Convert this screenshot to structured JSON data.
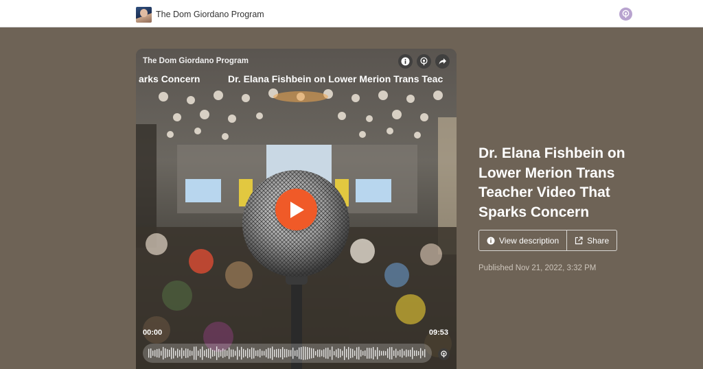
{
  "header": {
    "show_name": "The Dom Giordano Program",
    "avatar_icon": "host-avatar",
    "right_icon": "podcast-icon"
  },
  "player": {
    "show_name": "The Dom Giordano Program",
    "marquee_left": "arks Concern",
    "marquee_right": "Dr. Elana Fishbein on Lower Merion Trans Teac",
    "buttons": [
      "info-icon",
      "podcast-icon",
      "share-icon"
    ],
    "current_time": "00:00",
    "duration": "09:53",
    "progress": 0,
    "play_icon": "play-icon",
    "accent_color": "#f05a28"
  },
  "episode": {
    "title": "Dr. Elana Fishbein on Lower Merion Trans Teacher Video That Sparks Concern",
    "view_description_label": "View description",
    "share_label": "Share",
    "published": "Published Nov 21, 2022, 3:32 PM"
  },
  "colors": {
    "page_background": "#6e6356",
    "accent": "#f05a28"
  }
}
